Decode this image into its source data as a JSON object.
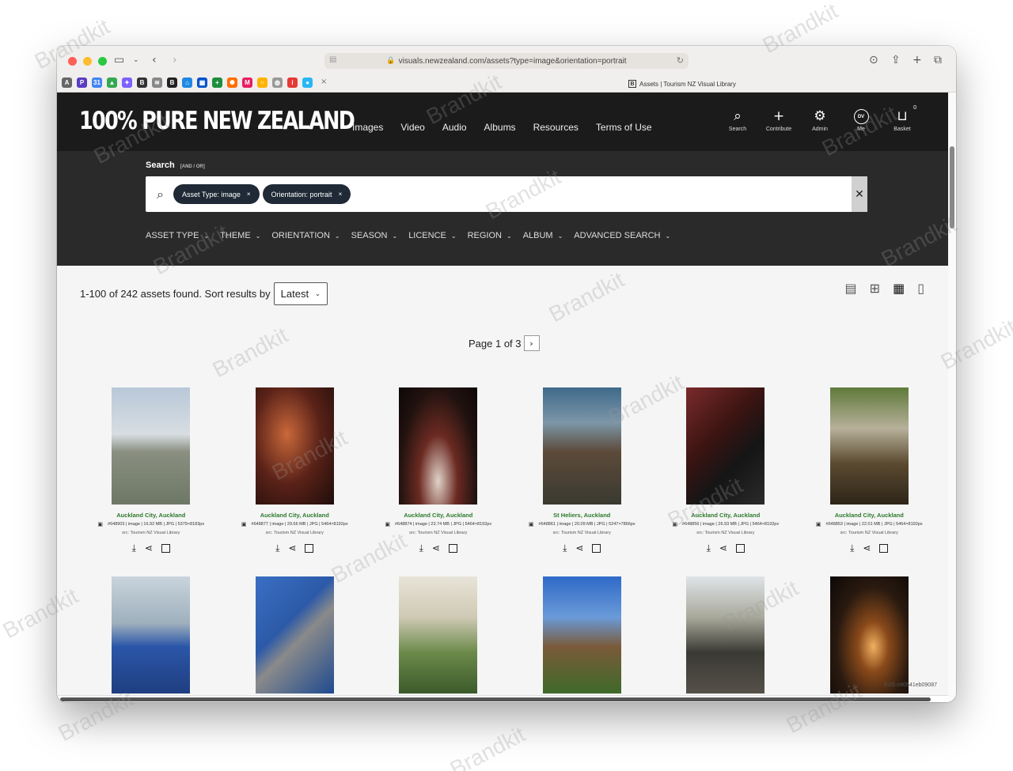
{
  "browser": {
    "url": "visuals.newzealand.com/assets?type=image&orientation=portrait",
    "tab_title": "Assets | Tourism NZ Visual Library",
    "tab_favicon": "B"
  },
  "site": {
    "logo": "100% PURE NEW ZEALAND",
    "nav": [
      "Images",
      "Video",
      "Audio",
      "Albums",
      "Resources",
      "Terms of Use"
    ],
    "tools": {
      "search": "Search",
      "contribute": "Contribute",
      "admin": "Admin",
      "me": "Me",
      "me_initials": "DV",
      "basket": "Basket",
      "basket_count": "0"
    }
  },
  "search": {
    "label": "Search",
    "mode": "[AND / OR]",
    "pills": [
      "Asset Type: image",
      "Orientation: portrait"
    ],
    "pill_close": "×",
    "clear": "✕",
    "filters": [
      "ASSET TYPE",
      "THEME",
      "ORIENTATION",
      "SEASON",
      "LICENCE",
      "REGION",
      "ALBUM",
      "ADVANCED SEARCH"
    ]
  },
  "results": {
    "summary": "1-100 of 242 assets found. Sort results by",
    "sort": "Latest",
    "pager": "Page 1 of 3",
    "pager_next": "›",
    "svg_id": "SVG-c80541eb09087"
  },
  "assets": [
    {
      "title": "Auckland City, Auckland",
      "meta": "#648903 | image | 16.92 MB | JPG | 5379×8183px",
      "src": "src: Tourism NZ Visual Library"
    },
    {
      "title": "Auckland City, Auckland",
      "meta": "#648877 | image | 29.66 MB | JPG | 5464×8192px",
      "src": "src: Tourism NZ Visual Library"
    },
    {
      "title": "Auckland City, Auckland",
      "meta": "#648874 | image | 23.74 MB | JPG | 5464×8192px",
      "src": "src: Tourism NZ Visual Library"
    },
    {
      "title": "St Heliers, Auckland",
      "meta": "#648861 | image | 20.09 MB | JPG | 5247×7866px",
      "src": "src: Tourism NZ Visual Library"
    },
    {
      "title": "Auckland City, Auckland",
      "meta": "#648856 | image | 26.93 MB | JPG | 5464×8192px",
      "src": "src: Tourism NZ Visual Library"
    },
    {
      "title": "Auckland City, Auckland",
      "meta": "#648853 | image | 22.01 MB | JPG | 5464×8192px",
      "src": "src: Tourism NZ Visual Library"
    }
  ],
  "watermark": "Brandkit"
}
